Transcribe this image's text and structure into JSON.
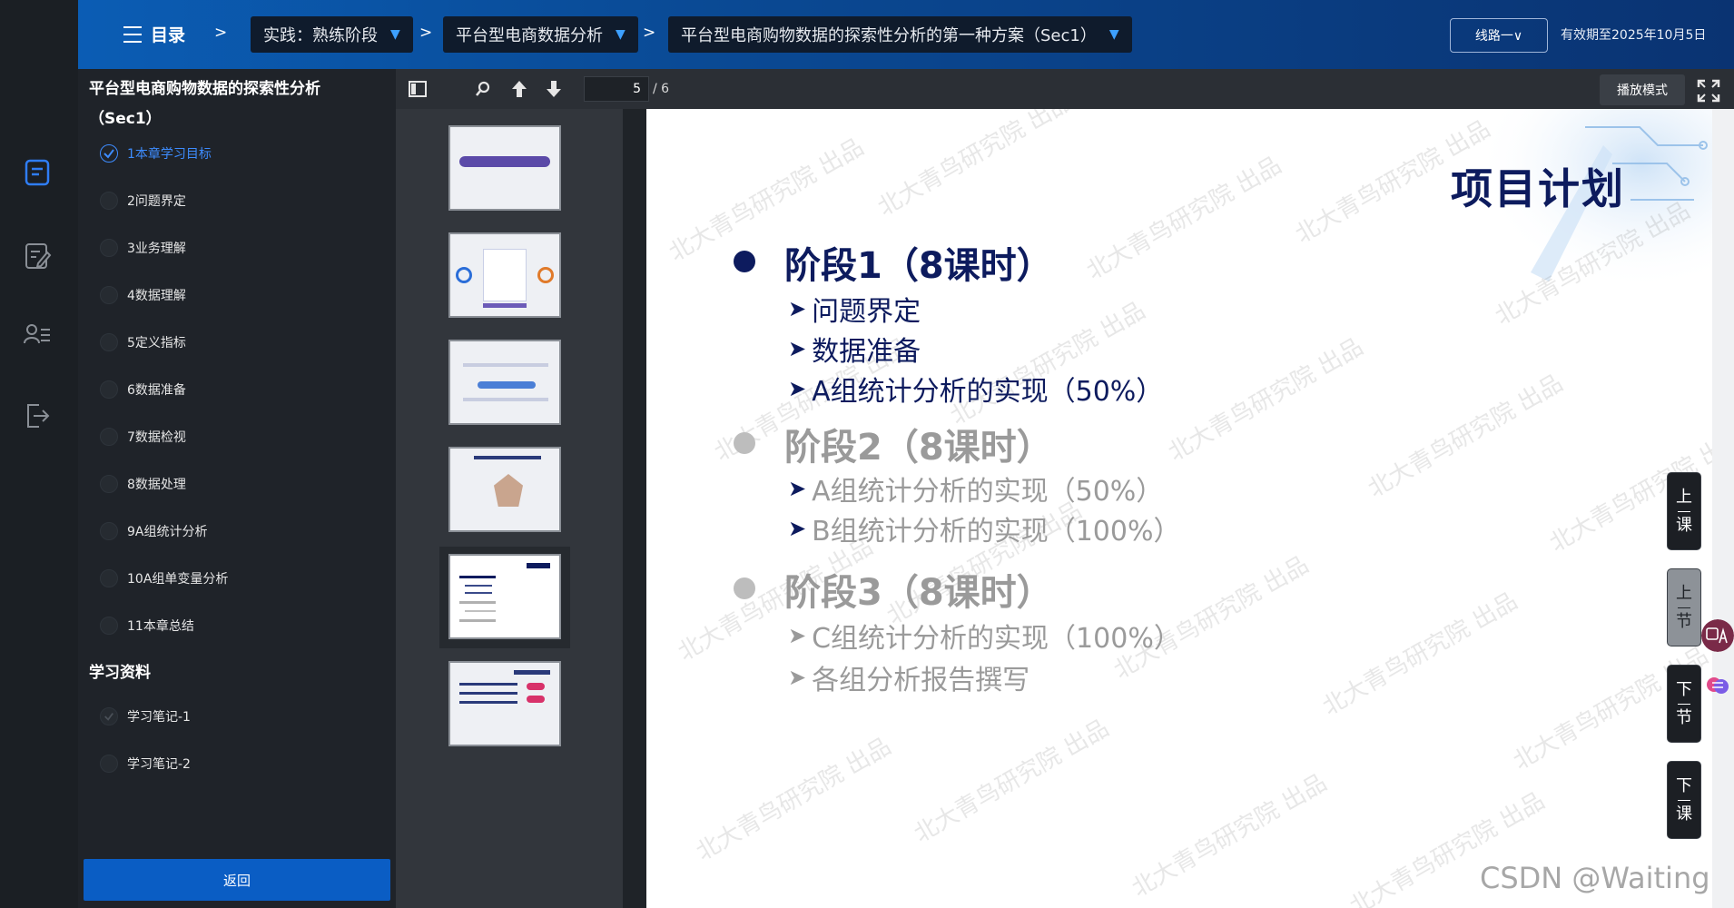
{
  "header": {
    "menu_label": "目录",
    "separator": ">",
    "breadcrumbs": [
      {
        "label": "实践：熟练阶段"
      },
      {
        "label": "平台型电商数据分析"
      },
      {
        "label": "平台型电商购物数据的探索性分析的第一种方案（Sec1）"
      }
    ],
    "route_button": "线路一∨",
    "valid_until": "有效期至2025年10月5日"
  },
  "sidebar": {
    "title": "平台型电商购物数据的探索性分析（Sec1）",
    "items": [
      {
        "label": "1本章学习目标",
        "active": true
      },
      {
        "label": "2问题界定"
      },
      {
        "label": "3业务理解"
      },
      {
        "label": "4数据理解"
      },
      {
        "label": "5定义指标"
      },
      {
        "label": "6数据准备"
      },
      {
        "label": "7数据检视"
      },
      {
        "label": "8数据处理"
      },
      {
        "label": "9A组统计分析"
      },
      {
        "label": "10A组单变量分析"
      },
      {
        "label": "11本章总结"
      }
    ],
    "resources_title": "学习资料",
    "resources": [
      {
        "label": "学习笔记-1"
      },
      {
        "label": "学习笔记-2"
      }
    ],
    "back_button": "返回"
  },
  "viewer": {
    "current_page": "5",
    "total_pages": "/ 6",
    "play_mode": "播放模式"
  },
  "slide": {
    "title": "项目计划",
    "phases": [
      {
        "label": "阶段1（8课时）",
        "items": [
          "问题界定",
          "数据准备",
          "A组统计分析的实现（50%）"
        ]
      },
      {
        "label": "阶段2（8课时）",
        "items": [
          "A组统计分析的实现（50%）",
          "B组统计分析的实现（100%）"
        ]
      },
      {
        "label": "阶段3（8课时）",
        "items": [
          "C组统计分析的实现（100%）",
          "各组分析报告撰写"
        ]
      }
    ],
    "watermark": "北大青鸟研究院 出品"
  },
  "side_nav": {
    "prev_lesson": [
      "上",
      "课"
    ],
    "prev_section": [
      "上",
      "节"
    ],
    "next_section": [
      "下",
      "节"
    ],
    "next_lesson": [
      "下",
      "课"
    ]
  },
  "footer_watermark": "CSDN @Waiting",
  "colors": {
    "accent": "#0a5dc4",
    "active": "#3d8cff",
    "phase_active": "#0d1b5e",
    "phase_inactive": "#9a9a9a"
  }
}
